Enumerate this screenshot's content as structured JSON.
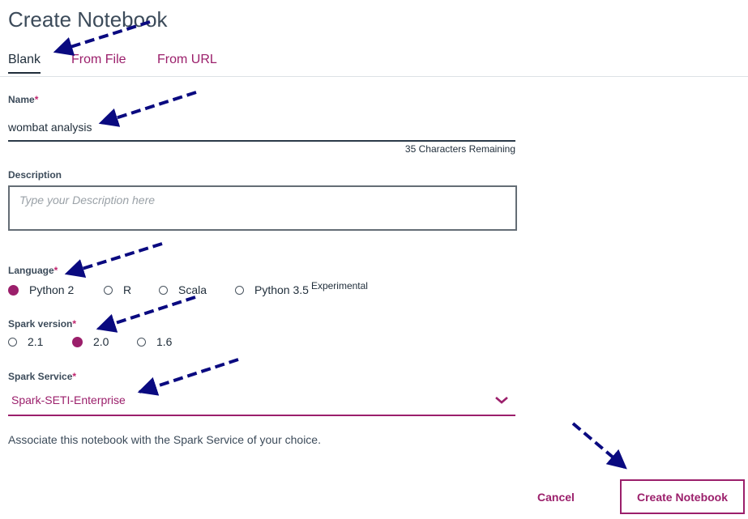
{
  "page": {
    "title": "Create Notebook"
  },
  "tabs": [
    "Blank",
    "From File",
    "From URL"
  ],
  "form": {
    "name": {
      "label": "Name",
      "required_mark": "*",
      "value": "wombat analysis",
      "remaining": "35 Characters Remaining"
    },
    "description": {
      "label": "Description",
      "placeholder": "Type your Description here"
    },
    "language": {
      "label": "Language",
      "required_mark": "*",
      "options": [
        {
          "label": "Python 2",
          "selected": true
        },
        {
          "label": "R",
          "selected": false
        },
        {
          "label": "Scala",
          "selected": false
        },
        {
          "label": "Python 3.5",
          "suffix": "Experimental",
          "selected": false
        }
      ]
    },
    "spark_version": {
      "label": "Spark version",
      "required_mark": "*",
      "options": [
        {
          "label": "2.1",
          "selected": false
        },
        {
          "label": "2.0",
          "selected": true
        },
        {
          "label": "1.6",
          "selected": false
        }
      ]
    },
    "spark_service": {
      "label": "Spark Service",
      "required_mark": "*",
      "value": "Spark-SETI-Enterprise",
      "helper": "Associate this notebook with the Spark Service of your choice."
    }
  },
  "actions": {
    "cancel": "Cancel",
    "create": "Create Notebook"
  },
  "colors": {
    "accent": "#9b1f6b",
    "annotation_arrow": "#0a0a80"
  },
  "icons": {
    "select": "chevron-down-icon"
  }
}
